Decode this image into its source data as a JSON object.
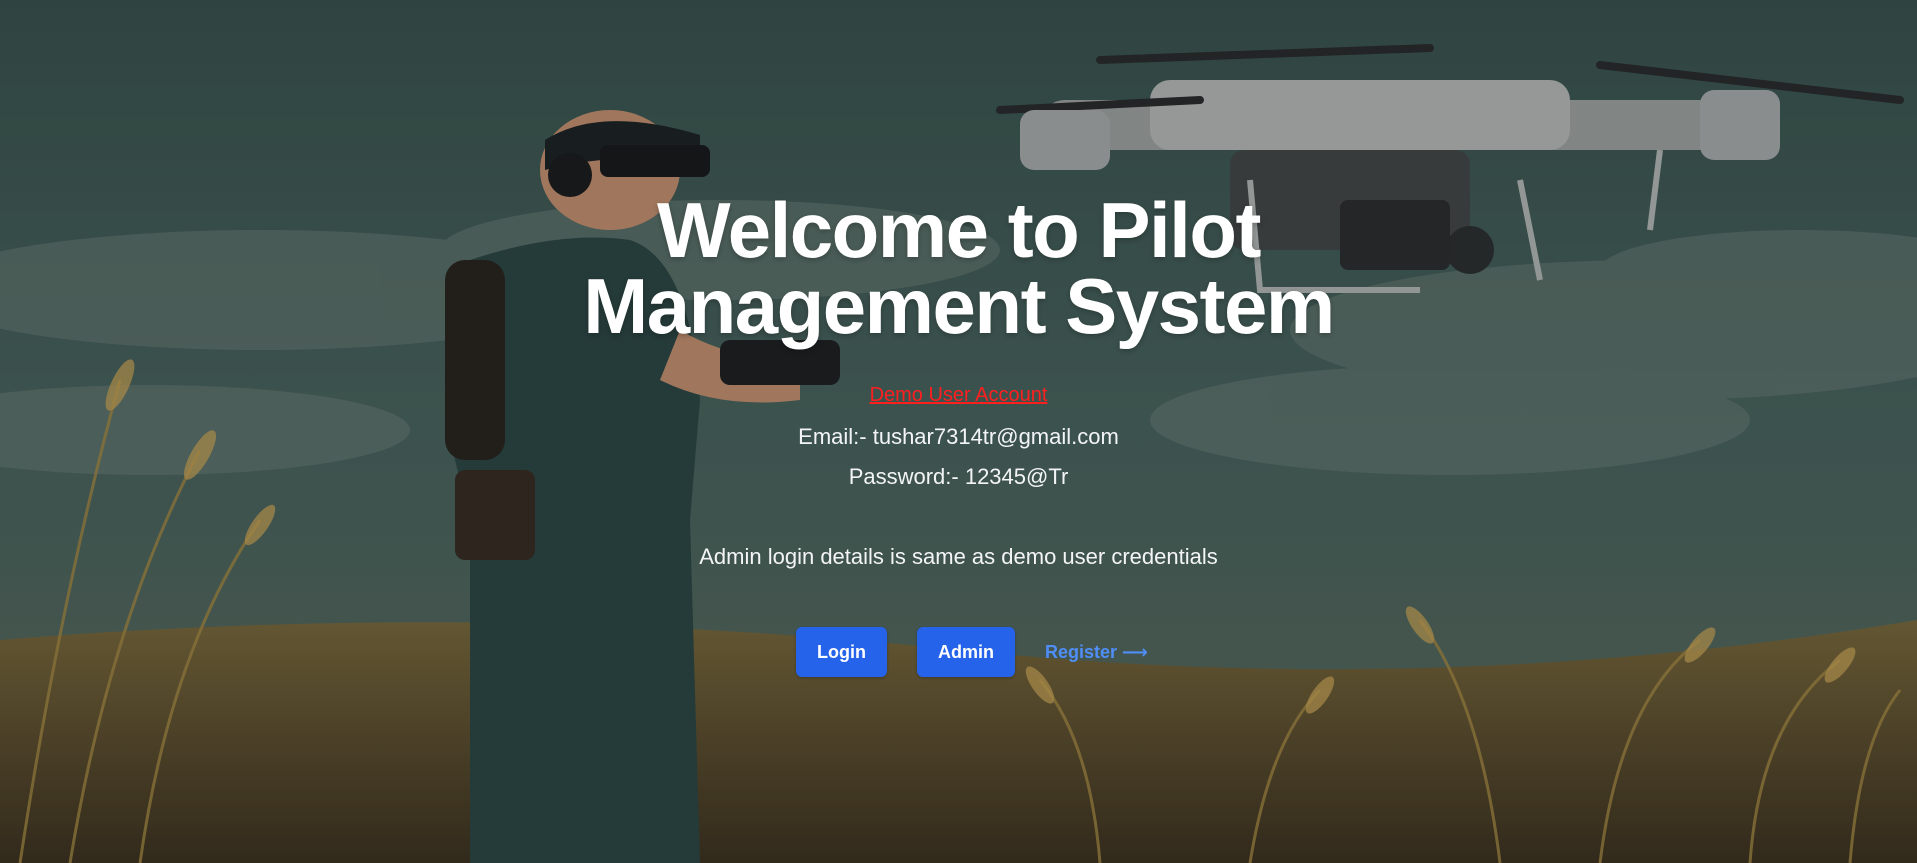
{
  "hero": {
    "title_line1": "Welcome to Pilot",
    "title_line2": "Management System"
  },
  "demo": {
    "link_text": "Demo User Account",
    "email_text": "Email:- tushar7314tr@gmail.com",
    "password_text": "Password:- 12345@Tr",
    "admin_note": "Admin login details is same as demo user credentials"
  },
  "actions": {
    "login_label": "Login",
    "admin_label": "Admin",
    "register_label": "Register ⟶"
  },
  "colors": {
    "primary_button": "#2563eb",
    "register_link": "#4f8ef7",
    "demo_link": "#ff1f1f",
    "background_sky": "#3c534f"
  },
  "background": {
    "icon": "drone-pilot-illustration"
  }
}
